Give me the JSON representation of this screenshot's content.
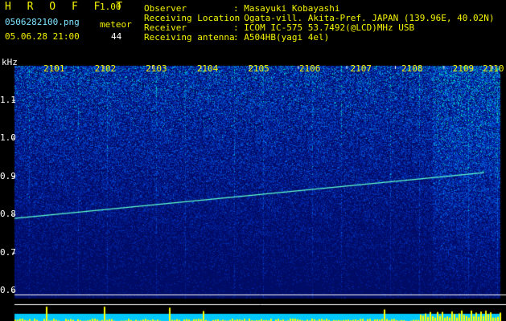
{
  "header": {
    "title": "H R O F F T",
    "version": "1.00",
    "filename": "0506282100.png",
    "meteor_label": "meteor",
    "datetime": "05.06.28 21:00",
    "meteor_count": "44"
  },
  "info": [
    {
      "label": "Observer",
      "value": "Masayuki Kobayashi"
    },
    {
      "label": "Receiving Location",
      "value": "Ogata-vill. Akita-Pref. JAPAN (139.96E, 40.02N)"
    },
    {
      "label": "Receiver",
      "value": "ICOM IC-575 53.7492(@LCD)MHz USB"
    },
    {
      "label": "Receiving antenna",
      "value": "A504HB(yagi 4el)"
    }
  ],
  "plot": {
    "y_unit": "kHz",
    "y_ticks": [
      "1.1",
      "1.0",
      "0.9",
      "0.8",
      "0.7",
      "0.6"
    ],
    "time_ticks": [
      "2101",
      "2102",
      "2103",
      "2104",
      "2105",
      "2106",
      "2107",
      "2108",
      "2109",
      "2110"
    ],
    "y_range": [
      0.58,
      1.19
    ],
    "meteor_trace_khz": {
      "start": 0.79,
      "end": 0.91
    }
  },
  "colors": {
    "text_yellow": "#f4f400",
    "text_cyan": "#7fe4ff",
    "noise_dark": "#001060",
    "noise_bright": "#00e0a0",
    "meter_bar": "#00c8ff",
    "meter_spike": "#ffff00"
  }
}
